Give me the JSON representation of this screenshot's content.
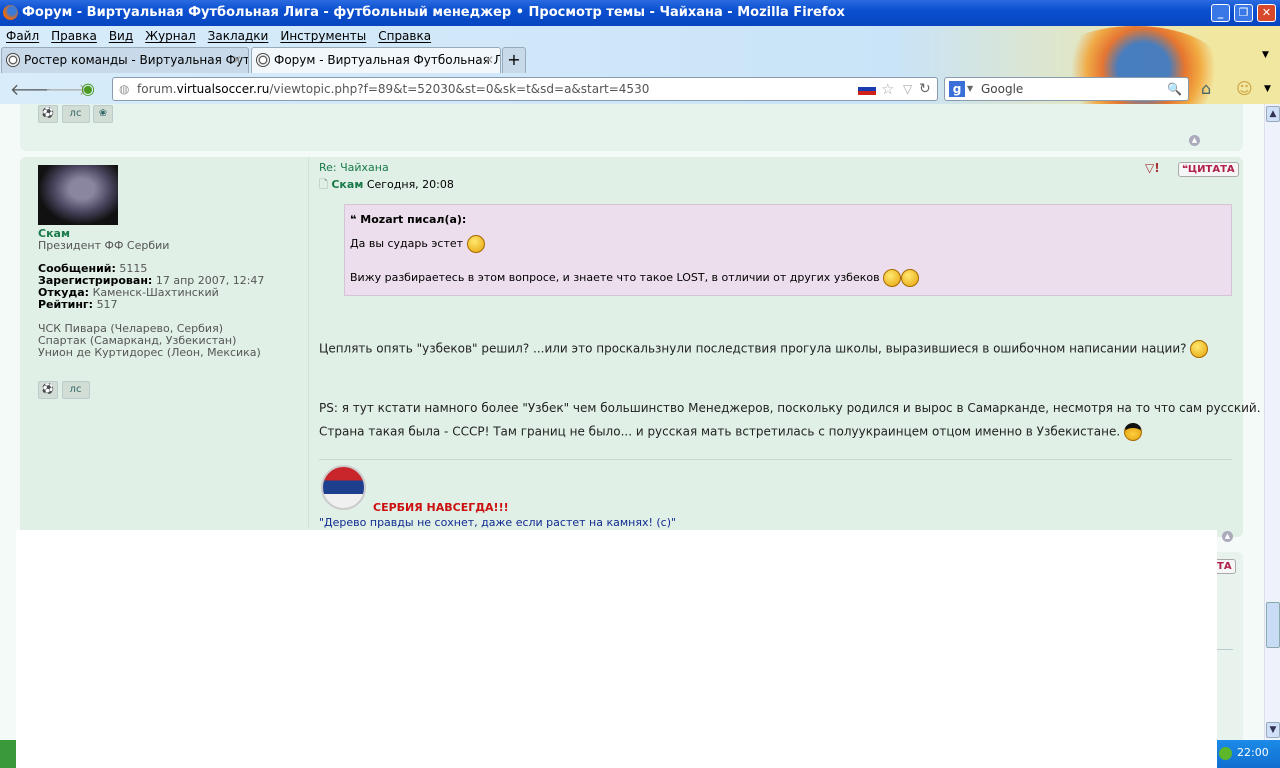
{
  "window": {
    "title": "Форум - Виртуальная Футбольная Лига - футбольный менеджер • Просмотр темы - Чайхана - Mozilla Firefox"
  },
  "menu": [
    "Файл",
    "Правка",
    "Вид",
    "Журнал",
    "Закладки",
    "Инструменты",
    "Справка"
  ],
  "tabs": [
    {
      "label": "Ростер команды - Виртуальная Футбо...",
      "active": false
    },
    {
      "label": "Форум - Виртуальная Футбольная Лиг...",
      "active": true
    }
  ],
  "url": {
    "domain_pre": "forum.",
    "domain": "virtualsoccer.ru",
    "path": "/viewtopic.php?f=89&t=52030&st=0&sk=t&sd=a&start=4530"
  },
  "search": {
    "engine": "Google"
  },
  "post": {
    "author": "Скам",
    "rank": "Президент ФФ Сербии",
    "stats": [
      {
        "k": "Сообщений:",
        "v": "5115"
      },
      {
        "k": "Зарегистрирован:",
        "v": "17 апр 2007, 12:47"
      },
      {
        "k": "Откуда:",
        "v": "Каменск-Шахтинский"
      },
      {
        "k": "Рейтинг:",
        "v": "517"
      }
    ],
    "teams": [
      "ЧСК Пивара (Челарево, Сербия)",
      "Спартак (Самарканд, Узбекистан)",
      "Унион де Куртидорес (Леон, Мексика)"
    ],
    "pm_label": "лс",
    "subject": "Re: Чайхана",
    "time": "Сегодня, 20:08",
    "quote_button": "ЦИТАТА",
    "quote": {
      "header": "Mozart писал(а):",
      "line1": "Да вы сударь эстет",
      "line2": "Вижу разбираетесь в этом вопросе, и знаете что такое LOST, в отличии от других узбеков"
    },
    "para1": "Цеплять опять \"узбеков\" решил? ...или это проскальзнули последствия прогула школы, выразившиеся в ошибочном написании нации?",
    "para2": "PS: я тут кстати намного более \"Узбек\" чем большинство Менеджеров, поскольку родился и вырос в Самарканде, несмотря на то что сам русский.",
    "para3": "Страна такая была - СССР! Там границ не было... и русская мать встретилась с полуукраинцем отцом именно в Узбекистане.",
    "sig_red": "СЕРБИЯ НАВСЕГДА!!!",
    "sig_blue": "\"Дерево правды не сохнет, даже если растет на камнях! (с)\""
  },
  "next_post": {
    "quote_button_partial": "ТА"
  },
  "clock": "22:00"
}
